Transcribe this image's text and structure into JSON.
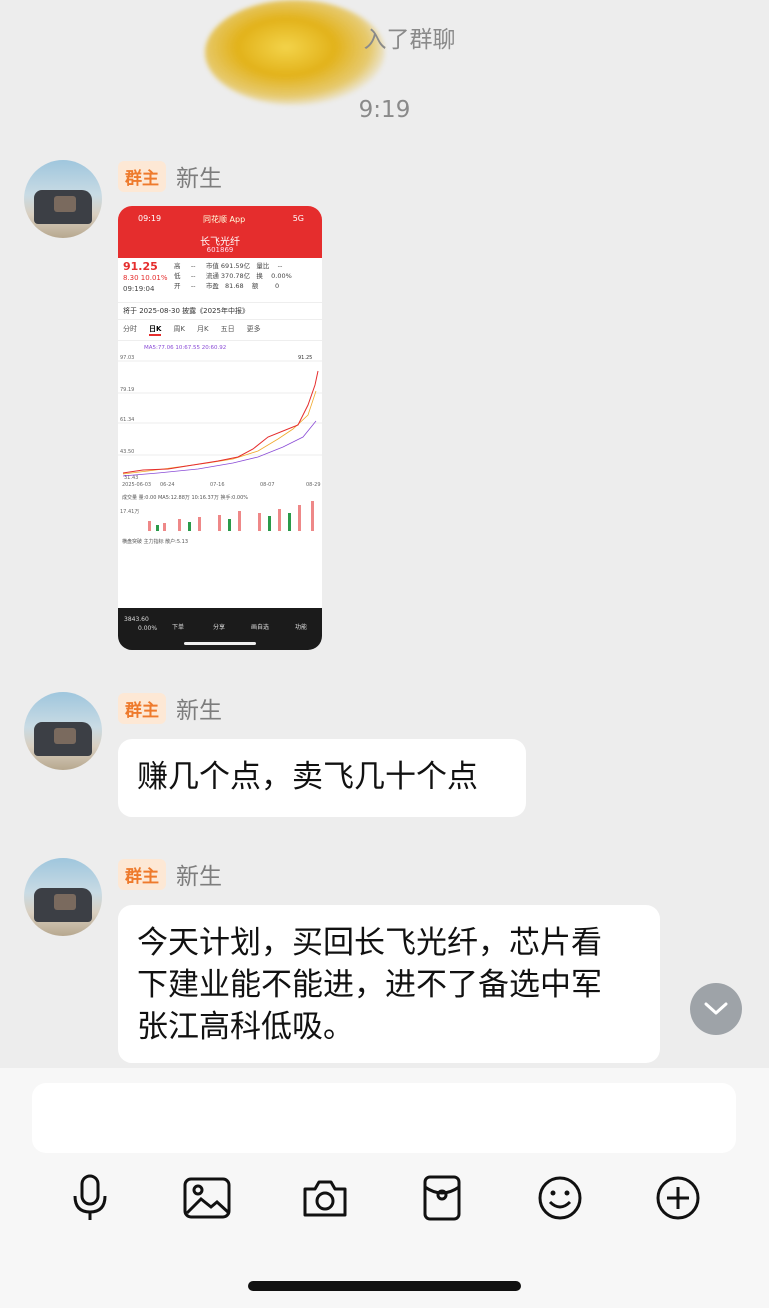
{
  "system": {
    "join_notice": "入了群聊",
    "time": "9:19"
  },
  "messages": [
    {
      "badge": "群主",
      "sender": "新生",
      "type": "image"
    },
    {
      "badge": "群主",
      "sender": "新生",
      "type": "text",
      "text": "赚几个点，卖飞几十个点"
    },
    {
      "badge": "群主",
      "sender": "新生",
      "type": "text",
      "text": "今天计划，买回长飞光纤，芯片看\n下建业能不能进，进不了备选中军\n张江高科低吸。"
    }
  ],
  "stock_image": {
    "status_time": "09:19",
    "app_name": "同花顺 App",
    "network": "5G",
    "stock_name": "长飞光纤",
    "stock_code": "601869",
    "price": "91.25",
    "change": "8.30  10.01%",
    "quote_time": "09:19:04",
    "quote_rows": "高     --     市值 691.59亿   量比    --\n低     --     流通 370.78亿   换    0.00%\n开     --     市盈   81.68    额        0",
    "banner": "将于 2025-08-30 披露《2025年中报》",
    "tabs": [
      "分时",
      "日K",
      "周K",
      "月K",
      "五日",
      "更多"
    ],
    "chart_labels": {
      "y_top": "97.03",
      "y2": "79.19",
      "y3": "61.34",
      "y4": "43.50",
      "low": "31.43",
      "last": "91.25",
      "dates": [
        "2025-06-03",
        "06-24",
        "07-16",
        "08-07",
        "08-29"
      ],
      "ma_line": "MA5:77.06  10:67.55  20:60.92",
      "volume_label": "成交量  量:0.00  MA5:12.88万  10:16.37万  换手:0.00%",
      "volume_axis": "17.41万",
      "bottom_label": "横盘突破  主力指标  散户:5.13"
    },
    "index_value": "3843.60",
    "index_change": "0.00%",
    "footer_items": [
      "下单",
      "分享",
      "画自选",
      "功能"
    ]
  },
  "input": {
    "placeholder": ""
  },
  "toolbar": {
    "icons": [
      "microphone-icon",
      "image-icon",
      "camera-icon",
      "red-packet-icon",
      "emoji-icon",
      "plus-icon"
    ]
  }
}
